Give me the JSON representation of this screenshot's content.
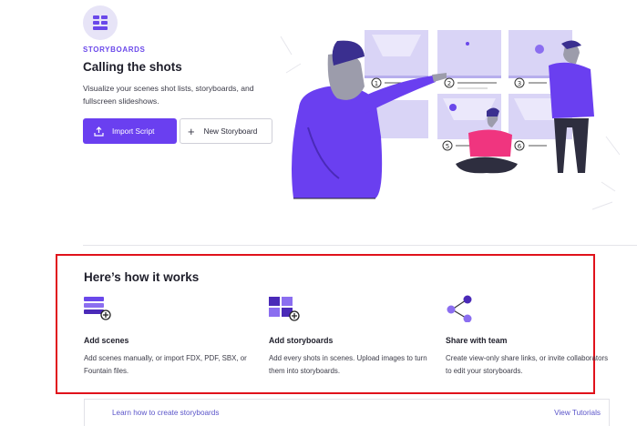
{
  "hero": {
    "eyebrow": "STORYBOARDS",
    "title": "Calling the shots",
    "description": "Visualize your scenes shot lists, storyboards, and fullscreen slideshows.",
    "import_button": "Import Script",
    "new_button": "New Storyboard",
    "accent_color": "#6a3ff0"
  },
  "illustration": {
    "panel_numbers": [
      "1",
      "2",
      "3",
      "4",
      "5",
      "6"
    ]
  },
  "how_it_works": {
    "title": "Here’s how it works",
    "steps": [
      {
        "icon": "add-scenes-icon",
        "title": "Add scenes",
        "description": "Add scenes manually, or import FDX, PDF, SBX, or Fountain files."
      },
      {
        "icon": "add-storyboards-icon",
        "title": "Add storyboards",
        "description": "Add every shots in scenes. Upload images to turn them into storyboards."
      },
      {
        "icon": "share-icon",
        "title": "Share with team",
        "description": "Create view-only share links, or invite collaborators to edit your storyboards."
      }
    ]
  },
  "tutorial": {
    "prefix": "Learn how to create ",
    "emphasis": "storyboards",
    "link": "View Tutorials"
  }
}
